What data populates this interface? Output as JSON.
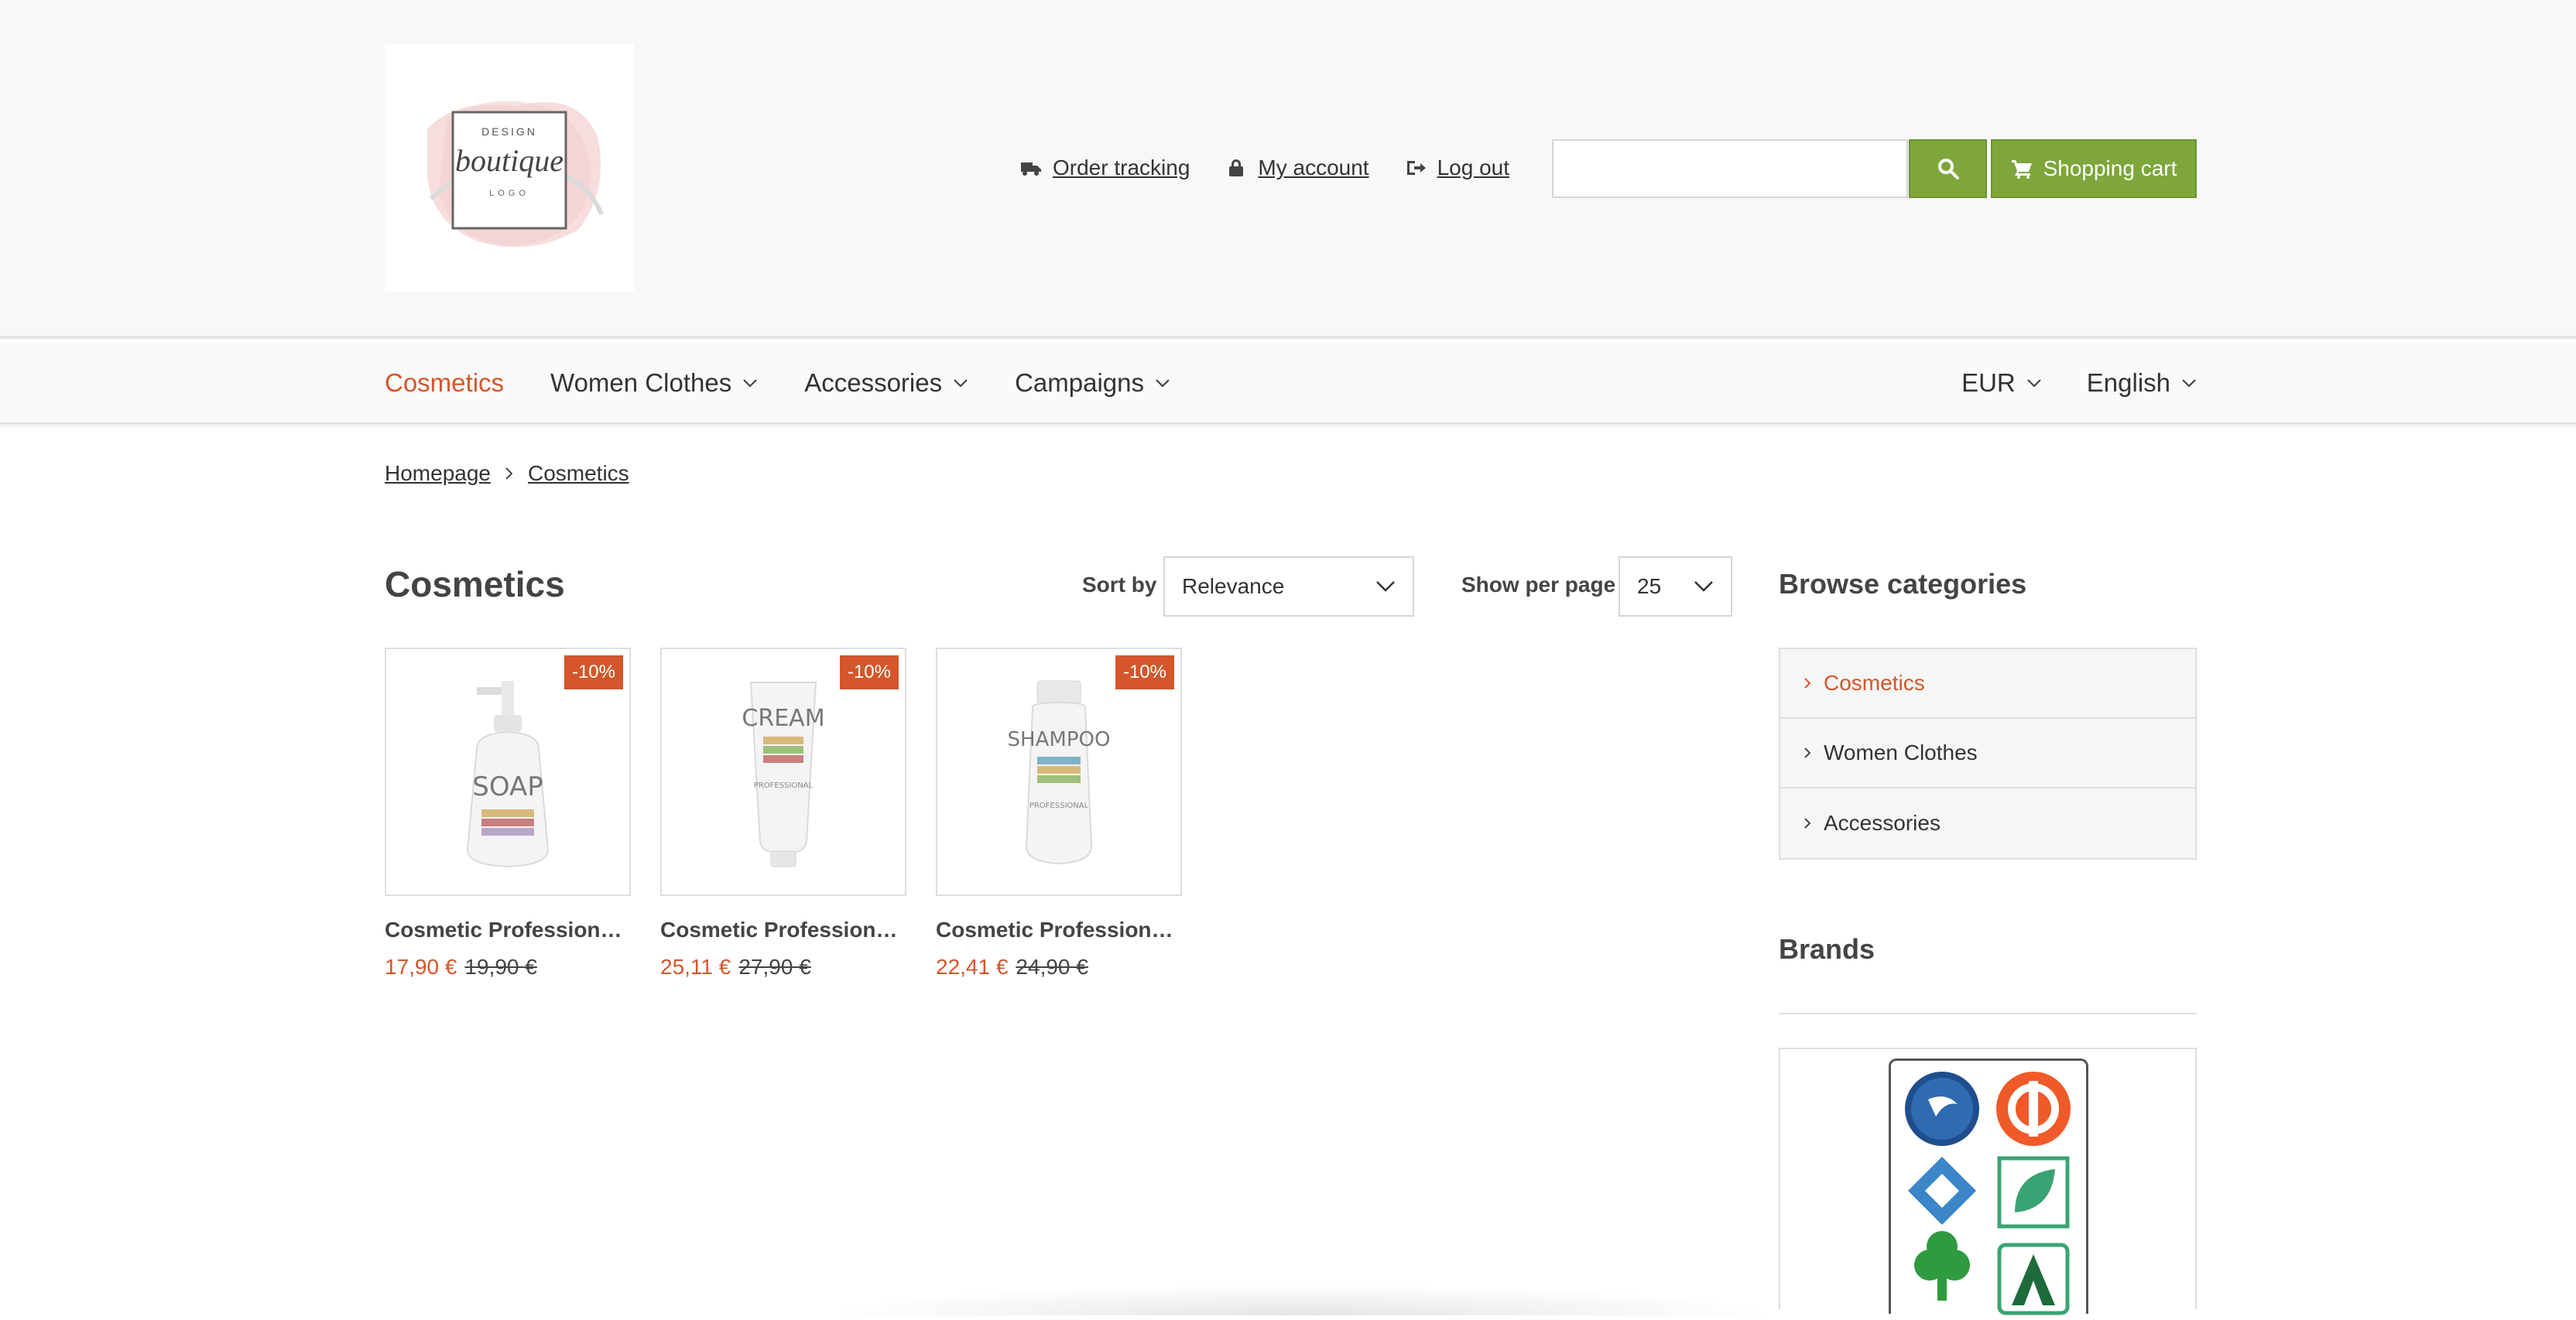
{
  "header": {
    "util_links": [
      {
        "label": "Order tracking",
        "icon": "truck-icon"
      },
      {
        "label": "My account",
        "icon": "lock-icon"
      },
      {
        "label": "Log out",
        "icon": "logout-icon"
      }
    ],
    "search": {
      "value": "",
      "placeholder": ""
    },
    "cart_label": "Shopping cart"
  },
  "nav": {
    "items": [
      {
        "label": "Cosmetics",
        "active": true
      },
      {
        "label": "Women Clothes"
      },
      {
        "label": "Accessories"
      },
      {
        "label": "Campaigns"
      }
    ],
    "currency": "EUR",
    "language": "English"
  },
  "breadcrumb": [
    "Homepage",
    "Cosmetics"
  ],
  "listing": {
    "title": "Cosmetics",
    "sort_label": "Sort by",
    "sort_value": "Relevance",
    "perpage_label": "Show per page",
    "perpage_value": "25",
    "products": [
      {
        "name": "Cosmetic Professional Soap",
        "badge": "-10%",
        "price": "17,90 €",
        "old_price": "19,90 €",
        "image": "soap-bottle"
      },
      {
        "name": "Cosmetic Professional Cream",
        "badge": "-10%",
        "price": "25,11 €",
        "old_price": "27,90 €",
        "image": "cream-tube"
      },
      {
        "name": "Cosmetic Professional Shampoo",
        "badge": "-10%",
        "price": "22,41 €",
        "old_price": "24,90 €",
        "image": "shampoo-bottle"
      }
    ]
  },
  "sidebar": {
    "categories_title": "Browse categories",
    "categories": [
      {
        "label": "Cosmetics",
        "active": true
      },
      {
        "label": "Women Clothes"
      },
      {
        "label": "Accessories"
      }
    ],
    "brands_title": "Brands"
  },
  "colors": {
    "accent": "#d4562a",
    "green": "#7ea63b"
  }
}
